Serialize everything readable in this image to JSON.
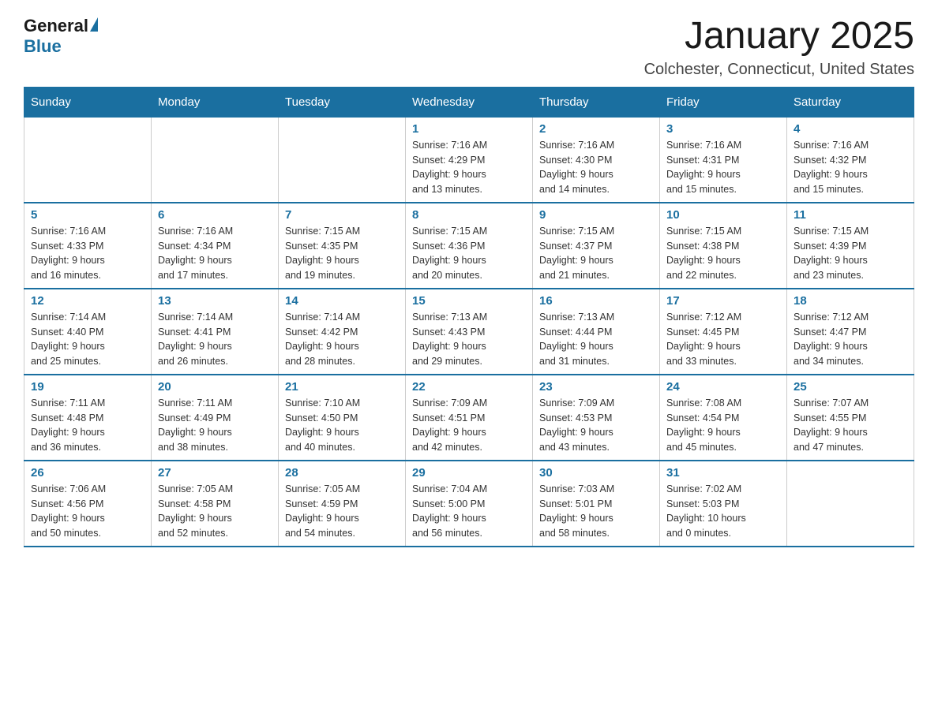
{
  "logo": {
    "general": "General",
    "blue": "Blue"
  },
  "title": "January 2025",
  "subtitle": "Colchester, Connecticut, United States",
  "weekdays": [
    "Sunday",
    "Monday",
    "Tuesday",
    "Wednesday",
    "Thursday",
    "Friday",
    "Saturday"
  ],
  "weeks": [
    [
      {
        "day": "",
        "info": ""
      },
      {
        "day": "",
        "info": ""
      },
      {
        "day": "",
        "info": ""
      },
      {
        "day": "1",
        "info": "Sunrise: 7:16 AM\nSunset: 4:29 PM\nDaylight: 9 hours\nand 13 minutes."
      },
      {
        "day": "2",
        "info": "Sunrise: 7:16 AM\nSunset: 4:30 PM\nDaylight: 9 hours\nand 14 minutes."
      },
      {
        "day": "3",
        "info": "Sunrise: 7:16 AM\nSunset: 4:31 PM\nDaylight: 9 hours\nand 15 minutes."
      },
      {
        "day": "4",
        "info": "Sunrise: 7:16 AM\nSunset: 4:32 PM\nDaylight: 9 hours\nand 15 minutes."
      }
    ],
    [
      {
        "day": "5",
        "info": "Sunrise: 7:16 AM\nSunset: 4:33 PM\nDaylight: 9 hours\nand 16 minutes."
      },
      {
        "day": "6",
        "info": "Sunrise: 7:16 AM\nSunset: 4:34 PM\nDaylight: 9 hours\nand 17 minutes."
      },
      {
        "day": "7",
        "info": "Sunrise: 7:15 AM\nSunset: 4:35 PM\nDaylight: 9 hours\nand 19 minutes."
      },
      {
        "day": "8",
        "info": "Sunrise: 7:15 AM\nSunset: 4:36 PM\nDaylight: 9 hours\nand 20 minutes."
      },
      {
        "day": "9",
        "info": "Sunrise: 7:15 AM\nSunset: 4:37 PM\nDaylight: 9 hours\nand 21 minutes."
      },
      {
        "day": "10",
        "info": "Sunrise: 7:15 AM\nSunset: 4:38 PM\nDaylight: 9 hours\nand 22 minutes."
      },
      {
        "day": "11",
        "info": "Sunrise: 7:15 AM\nSunset: 4:39 PM\nDaylight: 9 hours\nand 23 minutes."
      }
    ],
    [
      {
        "day": "12",
        "info": "Sunrise: 7:14 AM\nSunset: 4:40 PM\nDaylight: 9 hours\nand 25 minutes."
      },
      {
        "day": "13",
        "info": "Sunrise: 7:14 AM\nSunset: 4:41 PM\nDaylight: 9 hours\nand 26 minutes."
      },
      {
        "day": "14",
        "info": "Sunrise: 7:14 AM\nSunset: 4:42 PM\nDaylight: 9 hours\nand 28 minutes."
      },
      {
        "day": "15",
        "info": "Sunrise: 7:13 AM\nSunset: 4:43 PM\nDaylight: 9 hours\nand 29 minutes."
      },
      {
        "day": "16",
        "info": "Sunrise: 7:13 AM\nSunset: 4:44 PM\nDaylight: 9 hours\nand 31 minutes."
      },
      {
        "day": "17",
        "info": "Sunrise: 7:12 AM\nSunset: 4:45 PM\nDaylight: 9 hours\nand 33 minutes."
      },
      {
        "day": "18",
        "info": "Sunrise: 7:12 AM\nSunset: 4:47 PM\nDaylight: 9 hours\nand 34 minutes."
      }
    ],
    [
      {
        "day": "19",
        "info": "Sunrise: 7:11 AM\nSunset: 4:48 PM\nDaylight: 9 hours\nand 36 minutes."
      },
      {
        "day": "20",
        "info": "Sunrise: 7:11 AM\nSunset: 4:49 PM\nDaylight: 9 hours\nand 38 minutes."
      },
      {
        "day": "21",
        "info": "Sunrise: 7:10 AM\nSunset: 4:50 PM\nDaylight: 9 hours\nand 40 minutes."
      },
      {
        "day": "22",
        "info": "Sunrise: 7:09 AM\nSunset: 4:51 PM\nDaylight: 9 hours\nand 42 minutes."
      },
      {
        "day": "23",
        "info": "Sunrise: 7:09 AM\nSunset: 4:53 PM\nDaylight: 9 hours\nand 43 minutes."
      },
      {
        "day": "24",
        "info": "Sunrise: 7:08 AM\nSunset: 4:54 PM\nDaylight: 9 hours\nand 45 minutes."
      },
      {
        "day": "25",
        "info": "Sunrise: 7:07 AM\nSunset: 4:55 PM\nDaylight: 9 hours\nand 47 minutes."
      }
    ],
    [
      {
        "day": "26",
        "info": "Sunrise: 7:06 AM\nSunset: 4:56 PM\nDaylight: 9 hours\nand 50 minutes."
      },
      {
        "day": "27",
        "info": "Sunrise: 7:05 AM\nSunset: 4:58 PM\nDaylight: 9 hours\nand 52 minutes."
      },
      {
        "day": "28",
        "info": "Sunrise: 7:05 AM\nSunset: 4:59 PM\nDaylight: 9 hours\nand 54 minutes."
      },
      {
        "day": "29",
        "info": "Sunrise: 7:04 AM\nSunset: 5:00 PM\nDaylight: 9 hours\nand 56 minutes."
      },
      {
        "day": "30",
        "info": "Sunrise: 7:03 AM\nSunset: 5:01 PM\nDaylight: 9 hours\nand 58 minutes."
      },
      {
        "day": "31",
        "info": "Sunrise: 7:02 AM\nSunset: 5:03 PM\nDaylight: 10 hours\nand 0 minutes."
      },
      {
        "day": "",
        "info": ""
      }
    ]
  ]
}
